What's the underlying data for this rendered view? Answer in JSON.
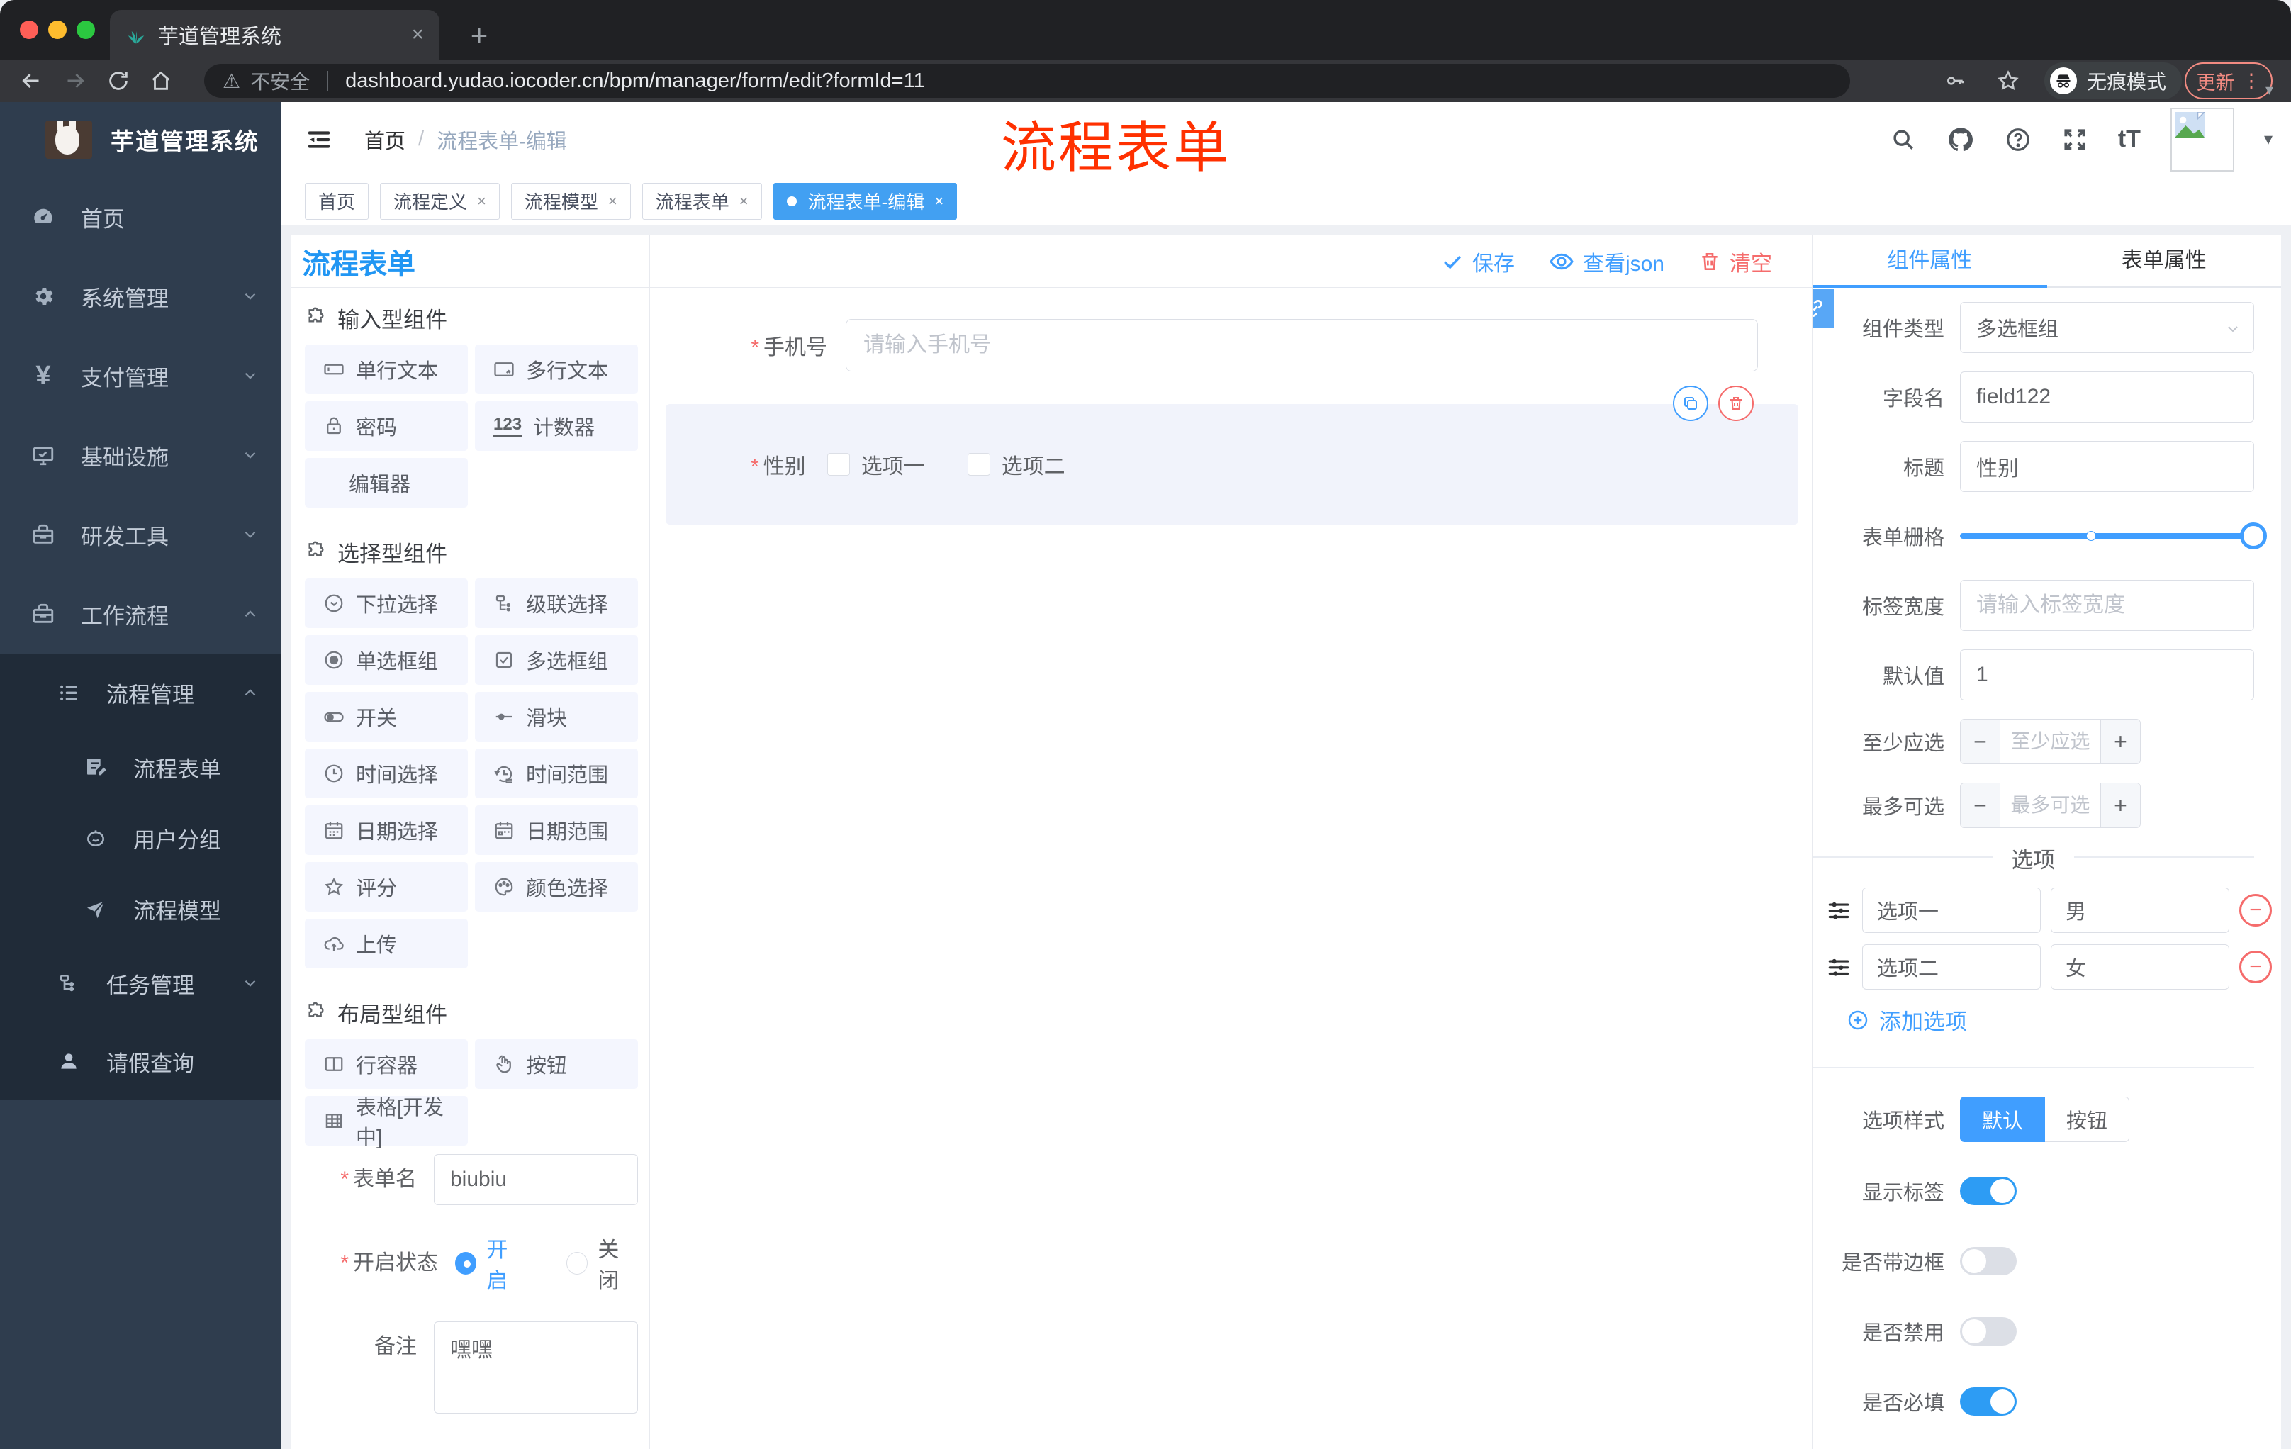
{
  "browser": {
    "tab_title": "芋道管理系统",
    "security_label": "不安全",
    "url": "dashboard.yudao.iocoder.cn/bpm/manager/form/edit?formId=11",
    "incognito_label": "无痕模式",
    "update_label": "更新"
  },
  "icons": {
    "close": "×",
    "plus": "+",
    "more": "⋮",
    "warning": "⚠",
    "caret": "▾",
    "question": "?",
    "counter": "123",
    "font_size": "tT",
    "minus": "−",
    "stepper_minus": "−",
    "stepper_plus": "+",
    "breadcrumb_sep": "/"
  },
  "header": {
    "breadcrumb": [
      "首页",
      "流程表单-编辑"
    ],
    "annotation": "流程表单",
    "annotation_color": "#ff3000"
  },
  "tabbar": {
    "tabs": [
      {
        "label": "首页"
      },
      {
        "label": "流程定义"
      },
      {
        "label": "流程模型"
      },
      {
        "label": "流程表单"
      },
      {
        "label": "流程表单-编辑"
      }
    ],
    "active": "流程表单-编辑"
  },
  "sidebar": {
    "title": "芋道管理系统",
    "items": [
      {
        "label": "首页"
      },
      {
        "label": "系统管理"
      },
      {
        "label": "支付管理"
      },
      {
        "label": "基础设施"
      },
      {
        "label": "研发工具"
      },
      {
        "label": "工作流程"
      },
      {
        "label": "流程管理"
      },
      {
        "label": "流程表单"
      },
      {
        "label": "用户分组"
      },
      {
        "label": "流程模型"
      },
      {
        "label": "任务管理"
      },
      {
        "label": "请假查询"
      }
    ]
  },
  "designer": {
    "title": "流程表单",
    "actions": {
      "save": "保存",
      "view_json": "查看json",
      "clear": "清空"
    }
  },
  "library": {
    "sections": [
      {
        "title": "输入型组件",
        "items": [
          {
            "label": "单行文本"
          },
          {
            "label": "多行文本"
          },
          {
            "label": "密码"
          },
          {
            "label": "计数器"
          },
          {
            "label": "编辑器"
          }
        ]
      },
      {
        "title": "选择型组件",
        "items": [
          {
            "label": "下拉选择"
          },
          {
            "label": "级联选择"
          },
          {
            "label": "单选框组"
          },
          {
            "label": "多选框组"
          },
          {
            "label": "开关"
          },
          {
            "label": "滑块"
          },
          {
            "label": "时间选择"
          },
          {
            "label": "时间范围"
          },
          {
            "label": "日期选择"
          },
          {
            "label": "日期范围"
          },
          {
            "label": "评分"
          },
          {
            "label": "颜色选择"
          },
          {
            "label": "上传"
          }
        ]
      },
      {
        "title": "布局型组件",
        "items": [
          {
            "label": "行容器"
          },
          {
            "label": "按钮"
          },
          {
            "label": "表格[开发中]"
          }
        ]
      }
    ]
  },
  "form_meta": {
    "name_label": "表单名",
    "name_value": "biubiu",
    "status_label": "开启状态",
    "status_options": [
      "开启",
      "关闭"
    ],
    "status_selected": "开启",
    "remark_label": "备注",
    "remark_value": "嘿嘿"
  },
  "canvas": {
    "phone": {
      "label": "手机号",
      "placeholder": "请输入手机号"
    },
    "gender": {
      "label": "性别",
      "options": [
        "选项一",
        "选项二"
      ]
    }
  },
  "panel": {
    "tabs": [
      "组件属性",
      "表单属性"
    ],
    "active_tab": "组件属性",
    "fields": {
      "component_type": {
        "label": "组件类型",
        "value": "多选框组"
      },
      "field_name": {
        "label": "字段名",
        "value": "field122"
      },
      "title": {
        "label": "标题",
        "value": "性别"
      },
      "grid": {
        "label": "表单栅格"
      },
      "label_width": {
        "label": "标签宽度",
        "placeholder": "请输入标签宽度"
      },
      "default_value": {
        "label": "默认值",
        "value": "1"
      },
      "min_select": {
        "label": "至少应选",
        "placeholder": "至少应选"
      },
      "max_select": {
        "label": "最多可选",
        "placeholder": "最多可选"
      }
    },
    "options_section": {
      "title": "选项",
      "rows": [
        {
          "label": "选项一",
          "value": "男"
        },
        {
          "label": "选项二",
          "value": "女"
        }
      ],
      "add_label": "添加选项"
    },
    "style": {
      "label": "选项样式",
      "options": [
        "默认",
        "按钮"
      ],
      "selected": "默认"
    },
    "toggles": [
      {
        "label": "显示标签",
        "on": true
      },
      {
        "label": "是否带边框",
        "on": false
      },
      {
        "label": "是否禁用",
        "on": false
      },
      {
        "label": "是否必填",
        "on": true
      }
    ]
  },
  "colors": {
    "accent": "#409eff",
    "danger": "#f56c6c",
    "sidebar_bg": "#2f3d4e",
    "submenu_bg": "#202b38"
  }
}
